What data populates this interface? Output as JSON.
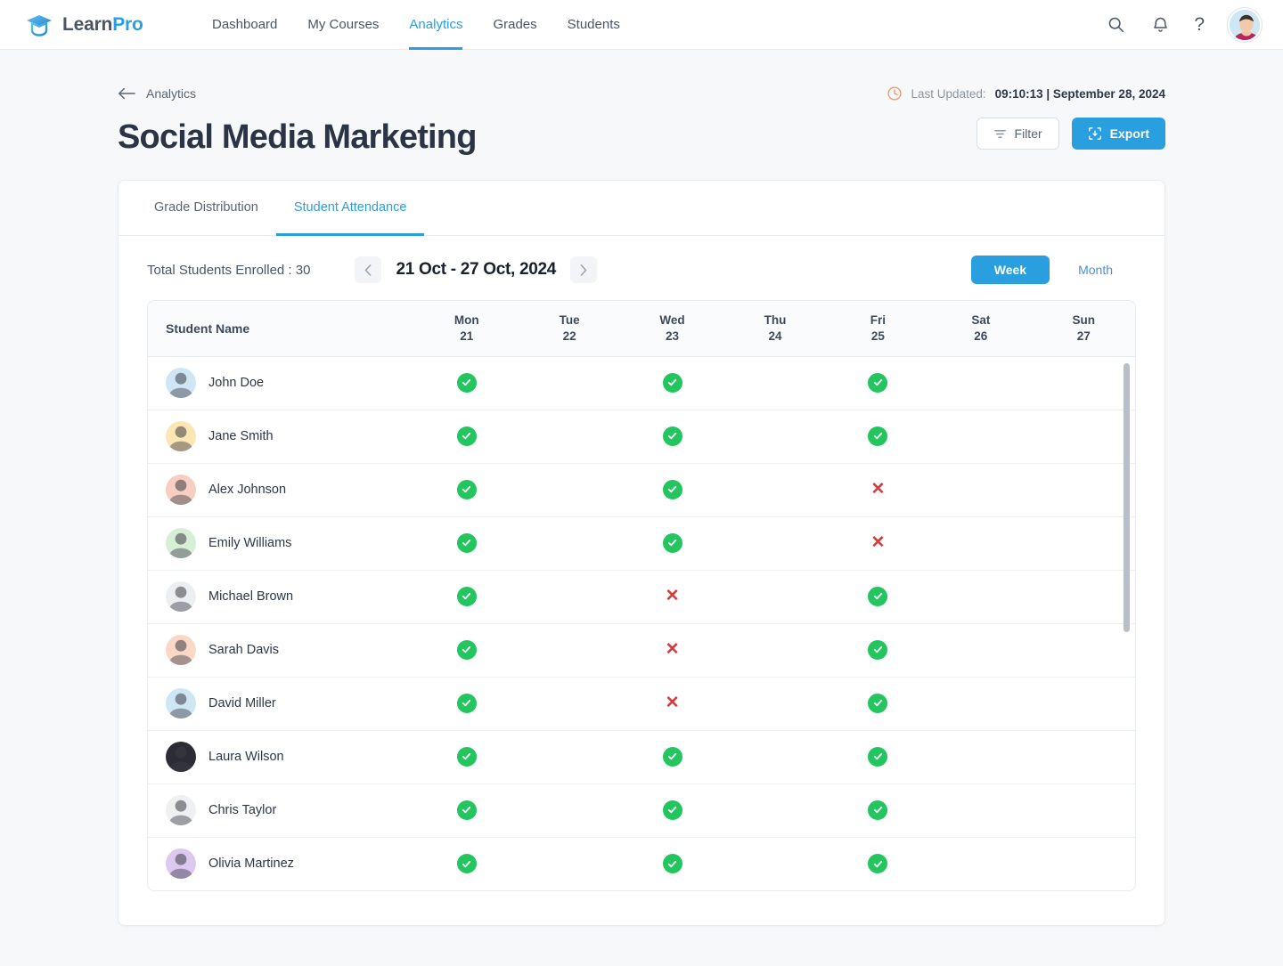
{
  "brand": {
    "learn": "Learn",
    "pro": "Pro",
    "icon": "graduation-cap-icon"
  },
  "nav": {
    "items": [
      {
        "label": "Dashboard",
        "active": false
      },
      {
        "label": "My Courses",
        "active": false
      },
      {
        "label": "Analytics",
        "active": true
      },
      {
        "label": "Grades",
        "active": false
      },
      {
        "label": "Students",
        "active": false
      }
    ],
    "accent": "#2a9fe0"
  },
  "topright": {
    "search_icon": "search-icon",
    "notification_icon": "bell-icon",
    "help_label": "?",
    "avatar": "user-avatar"
  },
  "breadcrumb": {
    "back_icon": "arrow-left-icon",
    "label": "Analytics"
  },
  "last_updated": {
    "icon": "clock-icon",
    "icon_color": "#f0976a",
    "label": "Last Updated:",
    "value": "09:10:13 | September 28, 2024"
  },
  "page_title": "Social Media Marketing",
  "actions": {
    "filter_label": "Filter",
    "filter_icon": "filter-icon",
    "export_label": "Export",
    "export_icon": "export-download-icon",
    "export_color": "#2a9fe0"
  },
  "tabs": [
    {
      "label": "Grade Distribution",
      "active": false
    },
    {
      "label": "Student Attendance",
      "active": true
    }
  ],
  "controls": {
    "enrolled_label": "Total Students Enrolled : ",
    "enrolled_count": "30",
    "prev_icon": "chevron-left-icon",
    "next_icon": "chevron-right-icon",
    "date_range": "21 Oct - 27 Oct, 2024",
    "view_options": [
      {
        "label": "Week",
        "active": true
      },
      {
        "label": "Month",
        "active": false
      }
    ]
  },
  "table": {
    "name_header": "Student Name",
    "days": [
      {
        "weekday": "Mon",
        "date": "21"
      },
      {
        "weekday": "Tue",
        "date": "22"
      },
      {
        "weekday": "Wed",
        "date": "23"
      },
      {
        "weekday": "Thu",
        "date": "24"
      },
      {
        "weekday": "Fri",
        "date": "25"
      },
      {
        "weekday": "Sat",
        "date": "26"
      },
      {
        "weekday": "Sun",
        "date": "27"
      }
    ],
    "present_icon": "check-circle-icon",
    "absent_icon": "cross-icon",
    "present_color": "#22c55e",
    "absent_color": "#d93a3a",
    "rows": [
      {
        "name": "John Doe",
        "avatar_bg": "#cfe6f5",
        "attendance": [
          "present",
          "",
          "present",
          "",
          "present",
          "",
          ""
        ]
      },
      {
        "name": "Jane Smith",
        "avatar_bg": "#fbe6b4",
        "attendance": [
          "present",
          "",
          "present",
          "",
          "present",
          "",
          ""
        ]
      },
      {
        "name": "Alex Johnson",
        "avatar_bg": "#f6cfc2",
        "attendance": [
          "present",
          "",
          "present",
          "",
          "absent",
          "",
          ""
        ]
      },
      {
        "name": "Emily Williams",
        "avatar_bg": "#d6efd6",
        "attendance": [
          "present",
          "",
          "present",
          "",
          "absent",
          "",
          ""
        ]
      },
      {
        "name": "Michael Brown",
        "avatar_bg": "#eceff2",
        "attendance": [
          "present",
          "",
          "absent",
          "",
          "present",
          "",
          ""
        ]
      },
      {
        "name": "Sarah Davis",
        "avatar_bg": "#fbd8c6",
        "attendance": [
          "present",
          "",
          "absent",
          "",
          "present",
          "",
          ""
        ]
      },
      {
        "name": "David Miller",
        "avatar_bg": "#cfe6f5",
        "attendance": [
          "present",
          "",
          "absent",
          "",
          "present",
          "",
          ""
        ]
      },
      {
        "name": "Laura Wilson",
        "avatar_bg": "#2c2c34",
        "attendance": [
          "present",
          "",
          "present",
          "",
          "present",
          "",
          ""
        ]
      },
      {
        "name": "Chris Taylor",
        "avatar_bg": "#eef0f1",
        "attendance": [
          "present",
          "",
          "present",
          "",
          "present",
          "",
          ""
        ]
      },
      {
        "name": "Olivia Martinez",
        "avatar_bg": "#ddc9f0",
        "attendance": [
          "present",
          "",
          "present",
          "",
          "present",
          "",
          ""
        ]
      }
    ]
  }
}
